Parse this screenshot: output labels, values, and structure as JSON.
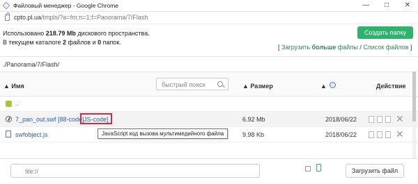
{
  "window": {
    "title": "Файловый менеджер - Google Chrome"
  },
  "address": {
    "host": "cpto.pl.ua",
    "path": "/tmpls/?a=fm;n=1;f=Panorama/7/Flash"
  },
  "info": {
    "used_prefix": "Использовано ",
    "used_value": "218.79 Mb",
    "used_suffix": " дискового пространства.",
    "catalog_prefix": "В текущем каталоге ",
    "files_count": "2",
    "files_mid": " файлов и ",
    "folders_count": "0",
    "folders_suffix": " папок."
  },
  "actions": {
    "create_folder": "Создать папку",
    "link_open": "[ ",
    "upload_prefix": "Загрузить ",
    "upload_bold": "больше",
    "upload_suffix": " файлы",
    "slash": " / ",
    "file_list": "Список файлов",
    "link_close": " ]"
  },
  "path": "./Panorama/7/Flash/",
  "table": {
    "col_name": "▲ Имя",
    "search_placeholder": "быстрый поиск",
    "col_size": "▲ Размер",
    "col_date": "▲",
    "col_action": "Действие",
    "up_row": "..",
    "rows": [
      {
        "name": "7_pan_out.swf",
        "code88": "[88-code]",
        "codejs": "JS-code]",
        "size": "6.92 Mb",
        "date": "2018/06/22"
      },
      {
        "name": "swfobject.js",
        "size": "9.98 Kb",
        "date": "2018/06/22"
      }
    ]
  },
  "tooltip": "JavaScript код вызова мультимедийного файла",
  "bottom": {
    "file_placeholder": "file://",
    "upload_button": "Загрузить файл"
  },
  "colors": {
    "green": "#2db36b",
    "link": "#2a62b0",
    "highlight": "#d8283b"
  },
  "icons": [
    "browser-logo-icon",
    "lock-icon",
    "search-icon",
    "sort-up-icon",
    "date-icon",
    "folder-up-icon",
    "flash-file-icon",
    "js-file-icon",
    "delete-icon",
    "mobile-icon"
  ]
}
